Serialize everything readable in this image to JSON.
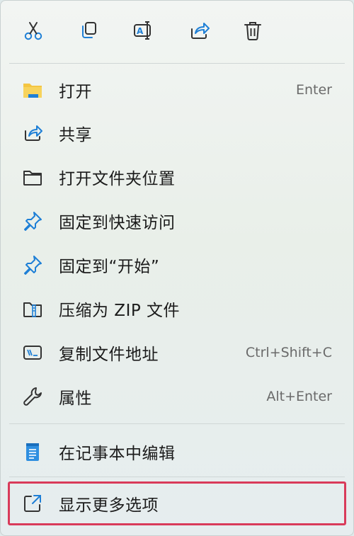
{
  "toolbar": {
    "items": [
      {
        "name": "cut",
        "icon": "scissors-icon"
      },
      {
        "name": "copy",
        "icon": "copy-icon"
      },
      {
        "name": "rename",
        "icon": "rename-icon"
      },
      {
        "name": "share",
        "icon": "share-icon"
      },
      {
        "name": "delete",
        "icon": "trash-icon"
      }
    ]
  },
  "menu": {
    "items": [
      {
        "label": "打开",
        "shortcut": "Enter",
        "icon": "folder-yellow-icon"
      },
      {
        "label": "共享",
        "shortcut": "",
        "icon": "share-icon"
      },
      {
        "label": "打开文件夹位置",
        "shortcut": "",
        "icon": "folder-outline-icon"
      },
      {
        "label": "固定到快速访问",
        "shortcut": "",
        "icon": "pin-icon"
      },
      {
        "label": "固定到“开始”",
        "shortcut": "",
        "icon": "pin-icon"
      },
      {
        "label": "压缩为 ZIP 文件",
        "shortcut": "",
        "icon": "zip-folder-icon"
      },
      {
        "label": "复制文件地址",
        "shortcut": "Ctrl+Shift+C",
        "icon": "copy-path-icon"
      },
      {
        "label": "属性",
        "shortcut": "Alt+Enter",
        "icon": "wrench-icon"
      },
      {
        "label": "在记事本中编辑",
        "shortcut": "",
        "icon": "notepad-icon"
      },
      {
        "label": "显示更多选项",
        "shortcut": "",
        "icon": "more-options-icon"
      }
    ]
  },
  "colors": {
    "accent_blue": "#1e7fd6",
    "folder_yellow": "#f4c542",
    "highlight_red": "#d93b5a"
  }
}
